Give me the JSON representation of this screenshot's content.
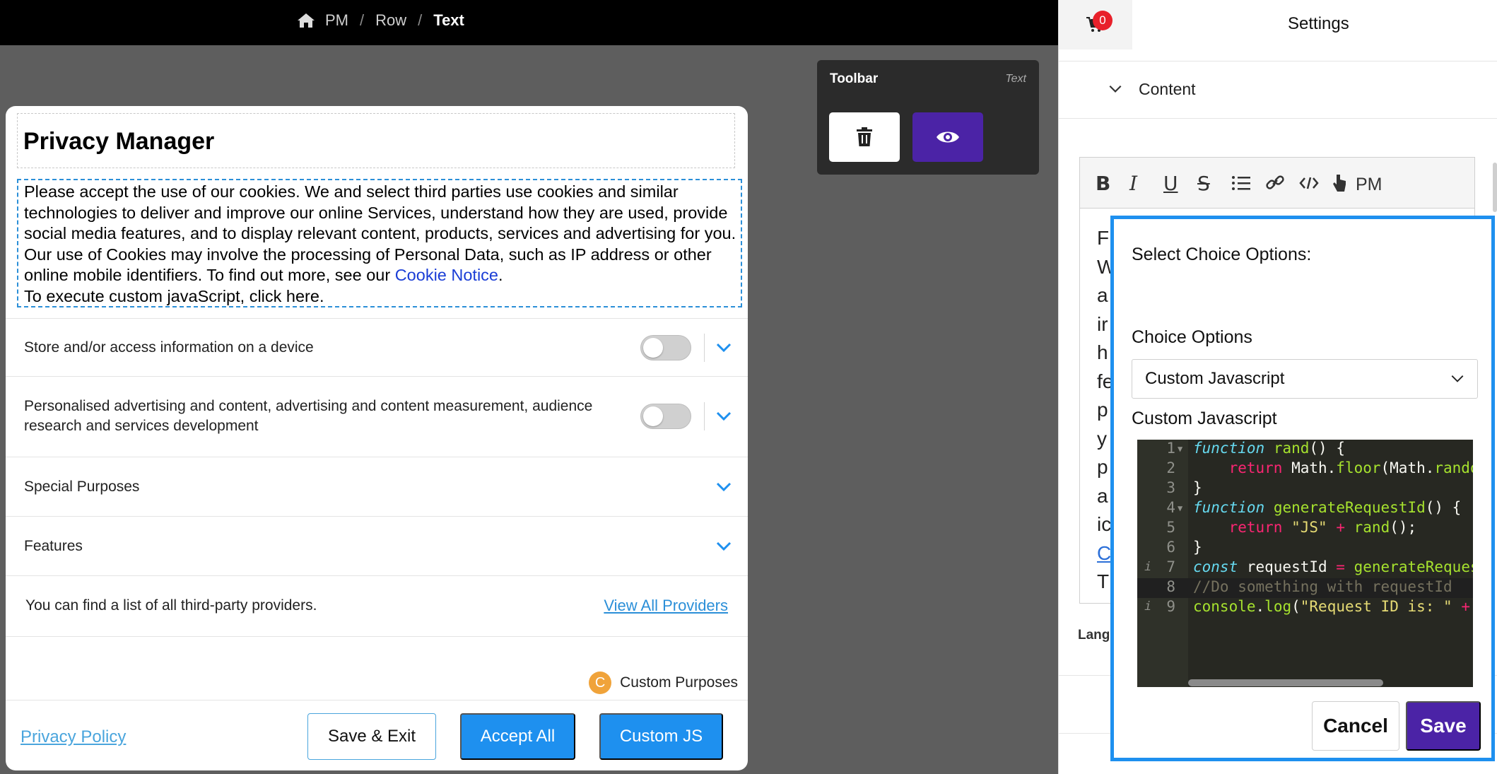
{
  "breadcrumb": {
    "items": [
      "PM",
      "Row"
    ],
    "current": "Text"
  },
  "toolbar": {
    "title": "Toolbar",
    "type": "Text",
    "delete_icon": "trash-icon",
    "preview_icon": "eye-icon"
  },
  "modal": {
    "title": "Privacy Manager",
    "description_parts": {
      "main": "Please accept the use of our cookies. We and select third parties use cookies and similar technologies to deliver and improve our online Services, understand how they are used, provide social media features, and to display relevant content, products, services and advertising for you. Our use of Cookies may involve the processing of Personal Data, such as IP address or other online mobile identifiers. To find out more, see our ",
      "link": "Cookie Notice",
      "after_link": ".",
      "custom_js": "To execute custom javaScript, click here."
    },
    "rows": [
      {
        "label": "Store and/or access information on a device"
      },
      {
        "label": "Personalised advertising and content, advertising and content measurement, audience research and services development"
      },
      {
        "label": "Special Purposes"
      },
      {
        "label": "Features"
      }
    ],
    "providers_text": "You can find a list of all third-party providers.",
    "providers_link": "View All Providers",
    "custom_purposes_badge": "C",
    "custom_purposes_label": "Custom Purposes",
    "footer": {
      "privacy_policy": "Privacy Policy",
      "save_exit": "Save & Exit",
      "accept_all": "Accept All",
      "custom_js": "Custom JS"
    }
  },
  "settings": {
    "cart_count": "0",
    "title": "Settings",
    "section": "Content",
    "editor_tools": [
      "B",
      "I",
      "U",
      "S",
      "list",
      "link",
      "code",
      "pointer"
    ],
    "editor_pm": "PM",
    "editor_visible_lines": [
      "F",
      "W",
      "a",
      "ir",
      "h",
      "fe",
      "p",
      "y",
      "p",
      "a",
      "ic",
      "C",
      "T"
    ],
    "lang_label": "Lang"
  },
  "popup": {
    "title": "Select Choice Options:",
    "choice_label": "Choice Options",
    "choice_value": "Custom Javascript",
    "code_label": "Custom Javascript",
    "code_lines": [
      "function rand() {",
      "    return Math.floor(Math.rando",
      "}",
      "function generateRequestId() {",
      "    return \"JS\" + rand();",
      "}",
      "const requestId = generateReques",
      "//Do something with requestId",
      "console.log(\"Request ID is: \" +"
    ],
    "cancel": "Cancel",
    "save": "Save"
  }
}
